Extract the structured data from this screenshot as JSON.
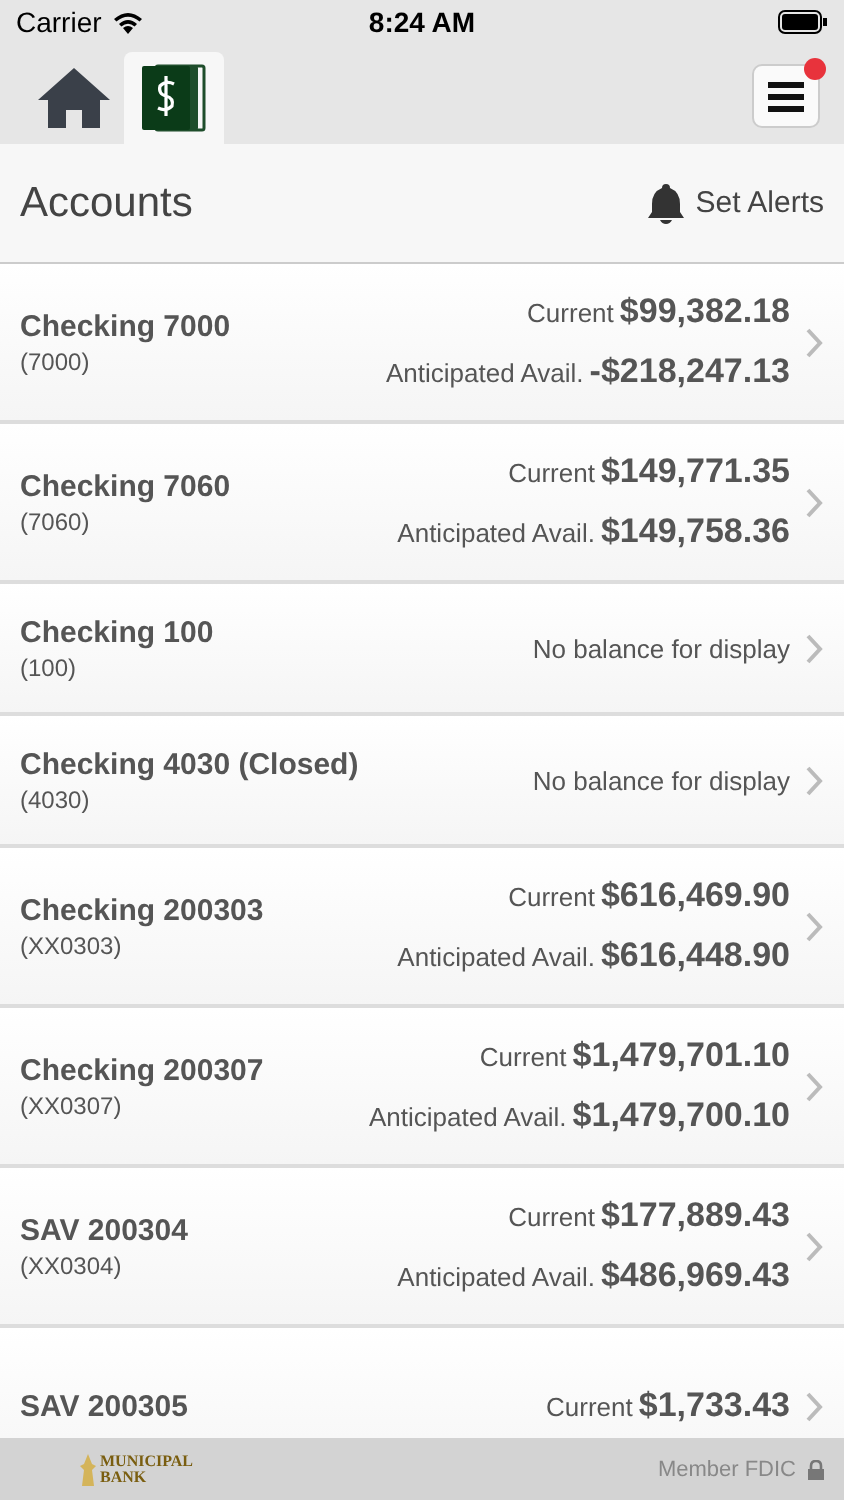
{
  "status_bar": {
    "carrier": "Carrier",
    "time": "8:24 AM"
  },
  "tabs": [
    {
      "kind": "home",
      "selected": false
    },
    {
      "kind": "money",
      "selected": true
    }
  ],
  "menu": {
    "notification": true
  },
  "header": {
    "title": "Accounts",
    "alerts_button": "Set Alerts"
  },
  "accounts": [
    {
      "name": "Checking 7000",
      "number": "(7000)",
      "kind": "balances",
      "balances": [
        {
          "label": "Current",
          "amount": "$99,382.18"
        },
        {
          "label": "Anticipated Avail.",
          "amount": "-$218,247.13"
        }
      ]
    },
    {
      "name": "Checking 7060",
      "number": "(7060)",
      "kind": "balances",
      "balances": [
        {
          "label": "Current",
          "amount": "$149,771.35"
        },
        {
          "label": "Anticipated Avail.",
          "amount": "$149,758.36"
        }
      ]
    },
    {
      "name": "Checking 100",
      "number": "(100)",
      "kind": "message",
      "message": "No balance for display"
    },
    {
      "name": "Checking 4030 (Closed)",
      "number": "(4030)",
      "kind": "message",
      "message": "No balance for display"
    },
    {
      "name": "Checking 200303",
      "number": "(XX0303)",
      "kind": "balances",
      "balances": [
        {
          "label": "Current",
          "amount": "$616,469.90"
        },
        {
          "label": "Anticipated Avail.",
          "amount": "$616,448.90"
        }
      ]
    },
    {
      "name": "Checking 200307",
      "number": "(XX0307)",
      "kind": "balances",
      "balances": [
        {
          "label": "Current",
          "amount": "$1,479,701.10"
        },
        {
          "label": "Anticipated Avail.",
          "amount": "$1,479,700.10"
        }
      ]
    },
    {
      "name": "SAV 200304",
      "number": "(XX0304)",
      "kind": "balances",
      "balances": [
        {
          "label": "Current",
          "amount": "$177,889.43"
        },
        {
          "label": "Anticipated Avail.",
          "amount": "$486,969.43"
        }
      ]
    },
    {
      "name": "SAV 200305",
      "kind": "balances",
      "balances": [
        {
          "label": "Current",
          "amount": "$1,733.43"
        }
      ]
    }
  ],
  "footer": {
    "logo_lines": [
      "MUNICIPAL",
      "BANK"
    ],
    "fdic": "Member FDIC"
  }
}
